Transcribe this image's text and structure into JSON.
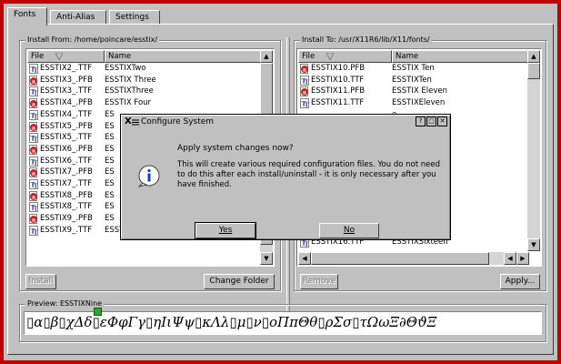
{
  "tabs": [
    "Fonts",
    "Anti-Alias",
    "Settings"
  ],
  "install_from": {
    "title": "Install From: /home/poincare/esstix/",
    "columns": [
      "File",
      "Name"
    ],
    "rows": [
      {
        "file": "ESSTIX2_.TTF",
        "name": "ESSTIXTwo",
        "type": "ttf"
      },
      {
        "file": "ESSTIX3_.PFB",
        "name": "ESSTIX Three",
        "type": "pfb"
      },
      {
        "file": "ESSTIX3_.TTF",
        "name": "ESSTIXThree",
        "type": "ttf"
      },
      {
        "file": "ESSTIX4_.PFB",
        "name": "ESSTIX Four",
        "type": "pfb"
      },
      {
        "file": "ESSTIX4_.TTF",
        "name": "ES",
        "type": "ttf"
      },
      {
        "file": "ESSTIX5_.PFB",
        "name": "ES",
        "type": "pfb"
      },
      {
        "file": "ESSTIX5_.TTF",
        "name": "ES",
        "type": "ttf"
      },
      {
        "file": "ESSTIX6_.PFB",
        "name": "ES",
        "type": "pfb"
      },
      {
        "file": "ESSTIX6_.TTF",
        "name": "ES",
        "type": "ttf"
      },
      {
        "file": "ESSTIX7_.PFB",
        "name": "ES",
        "type": "pfb"
      },
      {
        "file": "ESSTIX7_.TTF",
        "name": "ES",
        "type": "ttf"
      },
      {
        "file": "ESSTIX8_.PFB",
        "name": "ES",
        "type": "pfb"
      },
      {
        "file": "ESSTIX8_.TTF",
        "name": "ES",
        "type": "ttf"
      },
      {
        "file": "ESSTIX9_.PFB",
        "name": "ES",
        "type": "pfb"
      },
      {
        "file": "ESSTIX9_.TTF",
        "name": "ESSTIXNine",
        "type": "ttf"
      }
    ],
    "install_button": "Install",
    "change_folder_button": "Change Folder"
  },
  "install_to": {
    "title": "Install To: /usr/X11R6/lib/X11/fonts/",
    "columns": [
      "File",
      "Name"
    ],
    "rows": [
      {
        "file": "ESSTIX10.PFB",
        "name": "ESSTIX Ten",
        "type": "pfb"
      },
      {
        "file": "ESSTIX10.TTF",
        "name": "ESSTIXTen",
        "type": "ttf"
      },
      {
        "file": "ESSTIX11.PFB",
        "name": "ESSTIX Eleven",
        "type": "pfb"
      },
      {
        "file": "ESSTIX11.TTF",
        "name": "ESSTIXEleven",
        "type": "ttf"
      },
      {
        "file": "",
        "name": "e",
        "type": "none"
      },
      {
        "file": "",
        "name": "",
        "type": "none"
      },
      {
        "file": "",
        "name": "en",
        "type": "none"
      },
      {
        "file": "",
        "name": "en",
        "type": "none"
      },
      {
        "file": "",
        "name": "teen",
        "type": "none"
      },
      {
        "file": "",
        "name": "teen",
        "type": "none"
      },
      {
        "file": "",
        "name": "en",
        "type": "none"
      },
      {
        "file": "",
        "name": "en",
        "type": "none"
      },
      {
        "file": "",
        "name": "",
        "type": "none"
      },
      {
        "file": "",
        "name": "en",
        "type": "none"
      },
      {
        "file": "",
        "name": "",
        "type": "none"
      },
      {
        "file": "ESSTIX16.TTF",
        "name": "ESSTIXSixteen",
        "type": "ttf"
      }
    ],
    "remove_button": "Remove",
    "apply_button": "Apply..."
  },
  "preview": {
    "title": "Preview: ESSTIXNine",
    "text": "▯α▯β▯χΔδ▯εΦφΓγ▯ηΙιΨψ▯κΛλ▯μ▯ν▯οΠπΘθ▯ρΣσ▯τΩωΞ∂ΘϑΞ"
  },
  "dialog": {
    "title": "Configure System",
    "app_glyph": "X",
    "buttons_glyphs": [
      "?",
      "□",
      "✕"
    ],
    "question": "Apply system changes now?",
    "body": "This will create various required configuration files. You do not need to do this after each install/uninstall - it is only necessary after you have finished.",
    "yes": "Yes",
    "no": "No",
    "icon": "info-icon"
  },
  "colors": {
    "desktop": "#c00000",
    "face": "#c0c0c0",
    "pfb_icon": "#c0282a"
  }
}
